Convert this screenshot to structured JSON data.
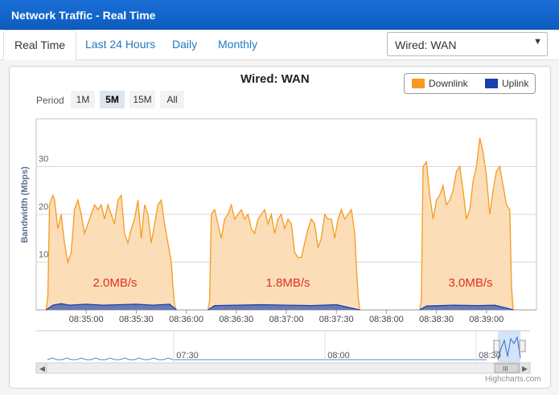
{
  "window": {
    "title": "Network Traffic - Real Time"
  },
  "tabs": [
    {
      "label": "Real Time",
      "active": true
    },
    {
      "label": "Last 24 Hours",
      "active": false
    },
    {
      "label": "Daily",
      "active": false
    },
    {
      "label": "Monthly",
      "active": false
    }
  ],
  "interface_select": {
    "value": "Wired: WAN"
  },
  "period": {
    "label": "Period",
    "options": [
      {
        "label": "1M",
        "selected": false
      },
      {
        "label": "5M",
        "selected": true
      },
      {
        "label": "15M",
        "selected": false
      },
      {
        "label": "All",
        "selected": false
      }
    ]
  },
  "credit": "Highcharts.com",
  "chart_data": {
    "type": "area",
    "title": "Wired: WAN",
    "ylabel": "Bandwidth (Mbps)",
    "ylim": [
      0,
      40
    ],
    "yticks": [
      10,
      20,
      30
    ],
    "xlim": [
      "08:34:30",
      "08:39:30"
    ],
    "xticks": [
      "08:35:00",
      "08:35:30",
      "08:36:00",
      "08:36:30",
      "08:37:00",
      "08:37:30",
      "08:38:00",
      "08:38:30",
      "08:39:00"
    ],
    "legend_position": "top-right",
    "colors": {
      "downlink": "#f79a1f",
      "downlink_fill": "#fbd9b0",
      "uplink": "#1a3fae",
      "uplink_fill": "#5a6fb0"
    },
    "series": [
      {
        "name": "Downlink",
        "x": [
          "08:34:36",
          "08:34:37",
          "08:34:38",
          "08:34:40",
          "08:34:41",
          "08:34:43",
          "08:34:45",
          "08:34:47",
          "08:34:49",
          "08:34:51",
          "08:34:53",
          "08:34:55",
          "08:34:57",
          "08:34:59",
          "08:35:01",
          "08:35:03",
          "08:35:05",
          "08:35:07",
          "08:35:09",
          "08:35:11",
          "08:35:13",
          "08:35:15",
          "08:35:17",
          "08:35:19",
          "08:35:21",
          "08:35:23",
          "08:35:25",
          "08:35:27",
          "08:35:29",
          "08:35:31",
          "08:35:33",
          "08:35:35",
          "08:35:37",
          "08:35:39",
          "08:35:41",
          "08:35:43",
          "08:35:45",
          "08:35:47",
          "08:35:49",
          "08:35:51",
          "08:35:52",
          "08:35:53",
          "08:35:54",
          "08:36:13",
          "08:36:14",
          "08:36:15",
          "08:36:17",
          "08:36:19",
          "08:36:21",
          "08:36:23",
          "08:36:25",
          "08:36:27",
          "08:36:29",
          "08:36:31",
          "08:36:33",
          "08:36:35",
          "08:36:37",
          "08:36:39",
          "08:36:41",
          "08:36:43",
          "08:36:45",
          "08:36:47",
          "08:36:49",
          "08:36:51",
          "08:36:53",
          "08:36:55",
          "08:36:57",
          "08:36:59",
          "08:37:01",
          "08:37:03",
          "08:37:05",
          "08:37:07",
          "08:37:09",
          "08:37:11",
          "08:37:13",
          "08:37:15",
          "08:37:17",
          "08:37:19",
          "08:37:21",
          "08:37:23",
          "08:37:25",
          "08:37:27",
          "08:37:29",
          "08:37:31",
          "08:37:33",
          "08:37:35",
          "08:37:37",
          "08:37:39",
          "08:37:41",
          "08:37:42",
          "08:37:43",
          "08:37:44",
          "08:38:20",
          "08:38:21",
          "08:38:22",
          "08:38:24",
          "08:38:26",
          "08:38:28",
          "08:38:30",
          "08:38:32",
          "08:38:34",
          "08:38:36",
          "08:38:38",
          "08:38:40",
          "08:38:42",
          "08:38:44",
          "08:38:46",
          "08:38:48",
          "08:38:50",
          "08:38:52",
          "08:38:54",
          "08:38:56",
          "08:38:58",
          "08:39:00",
          "08:39:02",
          "08:39:04",
          "08:39:06",
          "08:39:08",
          "08:39:10",
          "08:39:12",
          "08:39:14",
          "08:39:15",
          "08:39:16"
        ],
        "values": [
          0,
          3,
          22,
          24,
          23,
          17,
          20,
          14,
          10,
          12,
          21,
          23,
          20,
          16,
          18,
          20,
          22,
          21,
          22,
          19,
          22,
          20,
          18,
          23,
          24,
          16,
          14,
          17,
          19,
          23,
          15,
          22,
          20,
          14,
          18,
          22,
          23,
          18,
          14,
          10,
          5,
          1,
          0,
          0,
          2,
          20,
          21,
          18,
          15,
          19,
          20,
          22,
          19,
          20,
          21,
          19,
          20,
          17,
          16,
          19,
          20,
          21,
          18,
          20,
          16,
          19,
          20,
          17,
          19,
          18,
          12,
          11,
          11,
          14,
          17,
          19,
          18,
          13,
          15,
          20,
          19,
          19,
          15,
          19,
          21,
          19,
          20,
          21,
          16,
          9,
          3,
          0,
          0,
          2,
          30,
          31,
          24,
          19,
          23,
          24,
          26,
          22,
          23,
          25,
          29,
          30,
          25,
          19,
          21,
          27,
          30,
          36,
          33,
          28,
          20,
          25,
          29,
          30,
          26,
          22,
          21,
          5,
          0
        ],
        "annotation": "2.0MB/s|1.8MB/s|3.0MB/s"
      },
      {
        "name": "Uplink",
        "x": [
          "08:34:36",
          "08:34:40",
          "08:34:45",
          "08:34:50",
          "08:35:00",
          "08:35:10",
          "08:35:20",
          "08:35:30",
          "08:35:40",
          "08:35:50",
          "08:35:54",
          "08:36:13",
          "08:36:17",
          "08:36:30",
          "08:36:45",
          "08:37:00",
          "08:37:15",
          "08:37:30",
          "08:37:44",
          "08:38:20",
          "08:38:24",
          "08:38:40",
          "08:38:55",
          "08:39:05",
          "08:39:16"
        ],
        "values": [
          0,
          1,
          1.3,
          1,
          1.2,
          1,
          1.1,
          1.2,
          1,
          1.2,
          0,
          0,
          0.9,
          1,
          1.1,
          1,
          0.9,
          1.1,
          0,
          0,
          0.8,
          1,
          0.9,
          1,
          0
        ]
      }
    ],
    "annotations": [
      "2.0MB/s",
      "1.8MB/s",
      "3.0MB/s"
    ],
    "navigator_labels": [
      "07:30",
      "08:00",
      "08:30"
    ]
  }
}
